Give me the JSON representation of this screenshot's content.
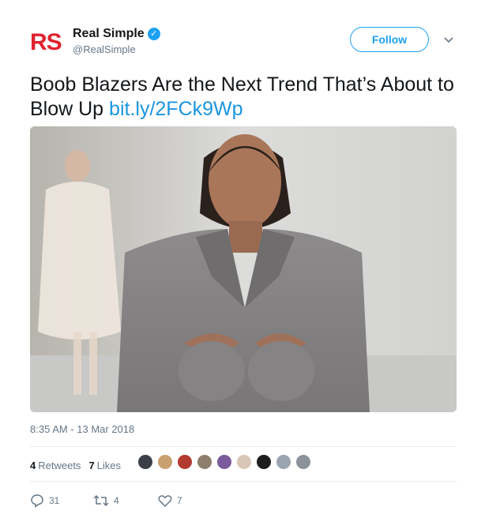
{
  "account": {
    "logo_text": "RS",
    "display_name": "Real Simple",
    "handle": "@RealSimple",
    "verified_glyph": "✓"
  },
  "follow_label": "Follow",
  "tweet": {
    "text": "Boob Blazers Are the Next Trend That’s About to Blow Up",
    "link": "bit.ly/2FCk9Wp"
  },
  "timestamp": "8:35 AM - 13 Mar 2018",
  "stats": {
    "retweets_count": "4",
    "retweets_label": "Retweets",
    "likes_count": "7",
    "likes_label": "Likes"
  },
  "liker_avatar_colors": [
    "#3c3f47",
    "#c9a06f",
    "#b33a2e",
    "#8e7f6d",
    "#7a5a9a",
    "#d8c7b6",
    "#1e1e1e",
    "#9aa5b1",
    "#8c9299"
  ],
  "actions": {
    "reply_count": "31",
    "retweet_count": "4",
    "like_count": "7"
  },
  "colors": {
    "brand_red": "#e0222f",
    "twitter_blue": "#1da1f2",
    "link_blue": "#1b95e0",
    "secondary_text": "#657786"
  },
  "icons": [
    "verified-icon",
    "chevron-down-icon",
    "reply-icon",
    "retweet-icon",
    "like-icon"
  ]
}
